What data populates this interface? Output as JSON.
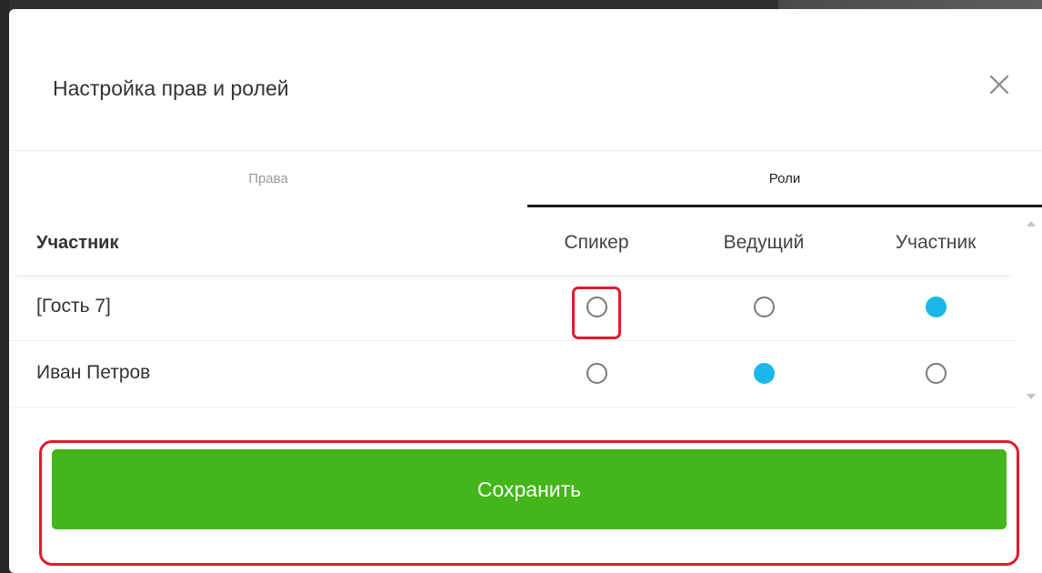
{
  "dialog": {
    "title": "Настройка прав и ролей"
  },
  "tabs": [
    {
      "label": "Права",
      "active": false
    },
    {
      "label": "Роли",
      "active": true
    }
  ],
  "table": {
    "columns": [
      "Участник",
      "Спикер",
      "Ведущий",
      "Участник"
    ],
    "rows": [
      {
        "name": "[Гость 7]",
        "roles": [
          false,
          false,
          true
        ]
      },
      {
        "name": "Иван Петров",
        "roles": [
          false,
          true,
          false
        ]
      }
    ]
  },
  "save_label": "Сохранить",
  "colors": {
    "accent_radio": "#1ab8e8",
    "save_button": "#44b51a",
    "highlight": "#e01b2d"
  },
  "icons": {
    "close": "close-icon",
    "scroll_up": "chevron-up-icon",
    "scroll_down": "chevron-down-icon"
  }
}
